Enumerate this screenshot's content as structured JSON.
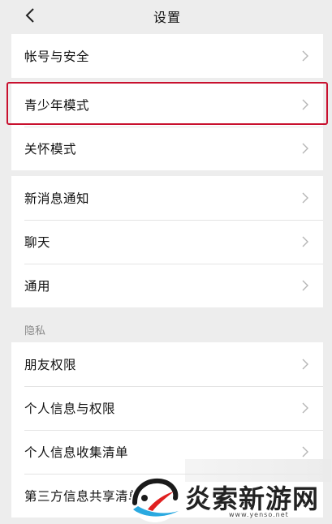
{
  "header": {
    "title": "设置"
  },
  "groups": [
    {
      "items": [
        {
          "label": "帐号与安全"
        }
      ]
    },
    {
      "items": [
        {
          "label": "青少年模式"
        },
        {
          "label": "关怀模式"
        }
      ]
    },
    {
      "items": [
        {
          "label": "新消息通知"
        },
        {
          "label": "聊天"
        },
        {
          "label": "通用"
        }
      ]
    },
    {
      "section": "隐私",
      "items": [
        {
          "label": "朋友权限"
        },
        {
          "label": "个人信息与权限"
        },
        {
          "label": "个人信息收集清单"
        },
        {
          "label": "第三方信息共享清单"
        }
      ]
    }
  ],
  "watermark": {
    "brand": "炎索新游网",
    "url": "www.yenso.net"
  },
  "colors": {
    "highlight": "#c8102e",
    "background": "#ededed",
    "chevron": "#b5b5b5"
  }
}
